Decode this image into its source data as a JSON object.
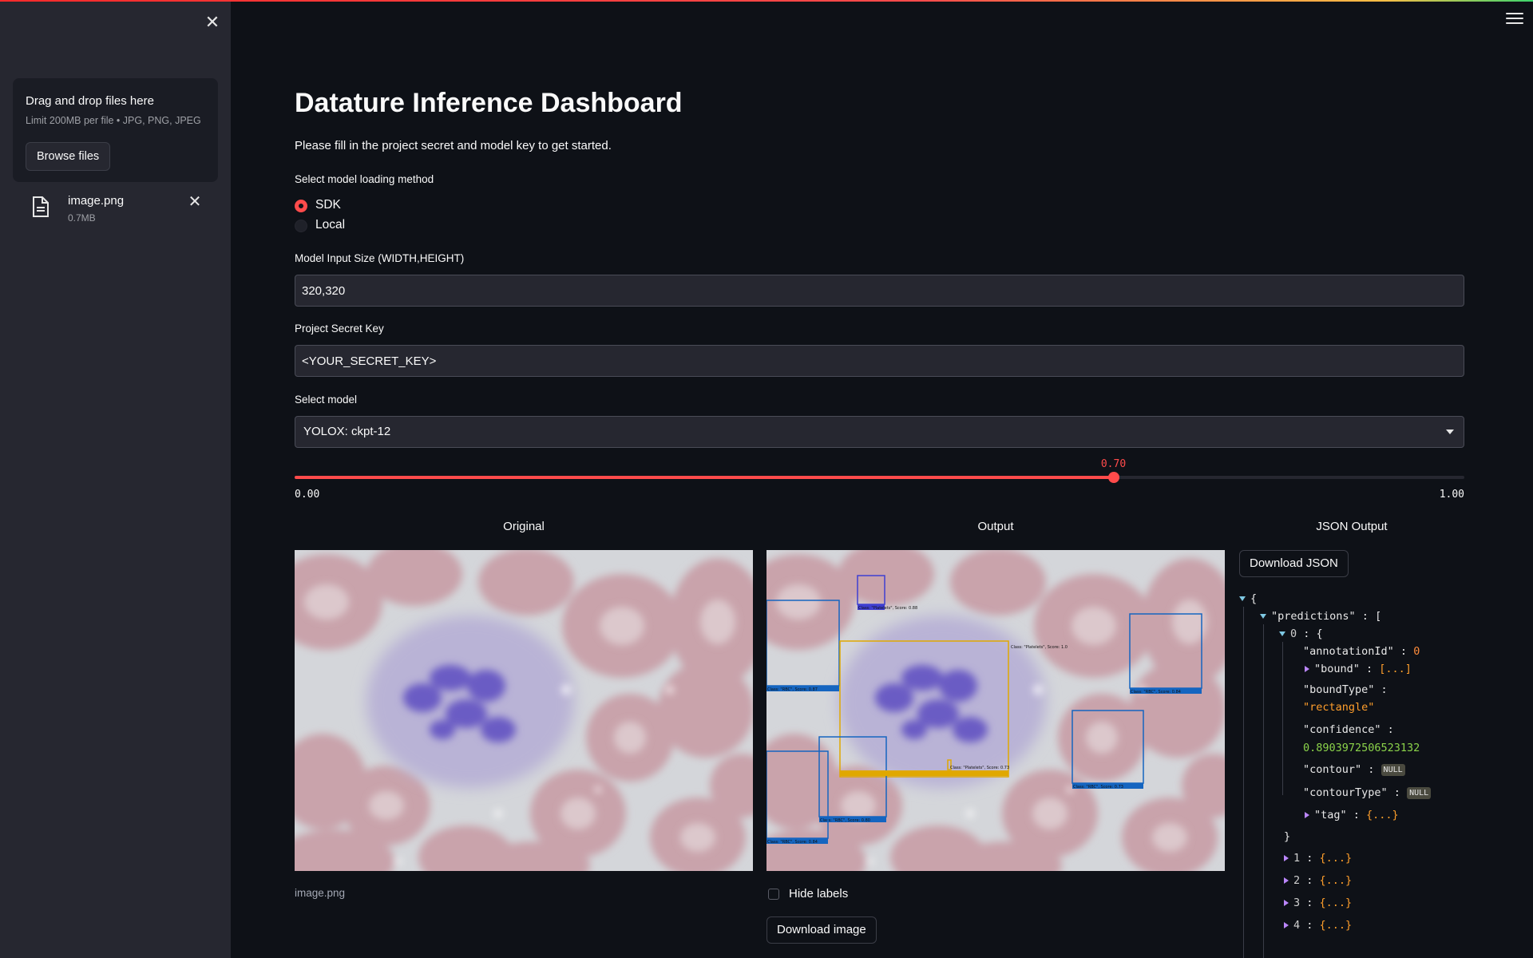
{
  "colors": {
    "accent": "#ff4b4b",
    "sidebar_bg": "#262730",
    "main_bg": "#0e1117"
  },
  "sidebar": {
    "close_icon": "close-icon",
    "uploader": {
      "title": "Drag and drop files here",
      "limit": "Limit 200MB per file • JPG, PNG, JPEG",
      "browse_label": "Browse files"
    },
    "file": {
      "name": "image.png",
      "size": "0.7MB",
      "icon": "file-icon",
      "remove_icon": "close-icon"
    }
  },
  "header": {
    "menu_icon": "hamburger-menu-icon"
  },
  "main": {
    "title": "Datature Inference Dashboard",
    "subtitle": "Please fill in the project secret and model key to get started.",
    "loading_method": {
      "label": "Select model loading method",
      "options": [
        {
          "label": "SDK",
          "selected": true
        },
        {
          "label": "Local",
          "selected": false
        }
      ]
    },
    "input_size": {
      "label": "Model Input Size (WIDTH,HEIGHT)",
      "value": "320,320"
    },
    "secret_key": {
      "label": "Project Secret Key",
      "value": "<YOUR_SECRET_KEY>"
    },
    "model_select": {
      "label": "Select model",
      "value": "YOLOX: ckpt-12"
    },
    "threshold_slider": {
      "value": 0.7,
      "value_text": "0.70",
      "min": "0.00",
      "max": "1.00",
      "min_value": 0,
      "max_value": 1
    },
    "columns": {
      "original": {
        "heading": "Original",
        "caption": "image.png"
      },
      "output": {
        "heading": "Output",
        "hide_labels": "Hide labels",
        "download_label": "Download image",
        "boxes": [
          {
            "label": "Class: \"RBC\", Score: 0.87",
            "color": "#1565c0"
          },
          {
            "label": "Class: \"Platelets\", Score: 0.88",
            "color": "#3f3fd1"
          },
          {
            "label": "Class: \"Platelets\", Score: 1.0",
            "color": "#e0a800"
          },
          {
            "label": "Class: \"RBC\", Score: 0.84",
            "color": "#1565c0"
          },
          {
            "label": "Class: \"Platelets\", Score: 0.73",
            "color": "#e0a800"
          },
          {
            "label": "Class: \"RBC\", Score: 0.80",
            "color": "#1565c0"
          },
          {
            "label": "Class: \"RBC\", Score: 0.84",
            "color": "#1565c0"
          },
          {
            "label": "Class: \"RBC\", Score: 0.73",
            "color": "#1565c0"
          },
          {
            "label": "Class: \"RBC\", Score: 0.86",
            "color": "#1565c0"
          }
        ]
      },
      "json": {
        "heading": "JSON Output",
        "download_label": "Download JSON",
        "root_open": "{",
        "predictions_key": "\"predictions\"",
        "predictions_open": "[",
        "item0_index": "0",
        "item0_open": "{",
        "annotationId_key": "\"annotationId\"",
        "annotationId_value": "0",
        "bound_key": "\"bound\"",
        "bound_value": "[...]",
        "boundType_key": "\"boundType\"",
        "boundType_value": "\"rectangle\"",
        "confidence_key": "\"confidence\"",
        "confidence_value": "0.8903972506523132",
        "contour_key": "\"contour\"",
        "contour_value": "NULL",
        "contourType_key": "\"contourType\"",
        "contourType_value": "NULL",
        "tag_key": "\"tag\"",
        "tag_value": "{...}",
        "item0_close": "}",
        "collapsed_items": [
          "1",
          "2",
          "3",
          "4"
        ],
        "collapsed_value": "{...}"
      }
    }
  }
}
